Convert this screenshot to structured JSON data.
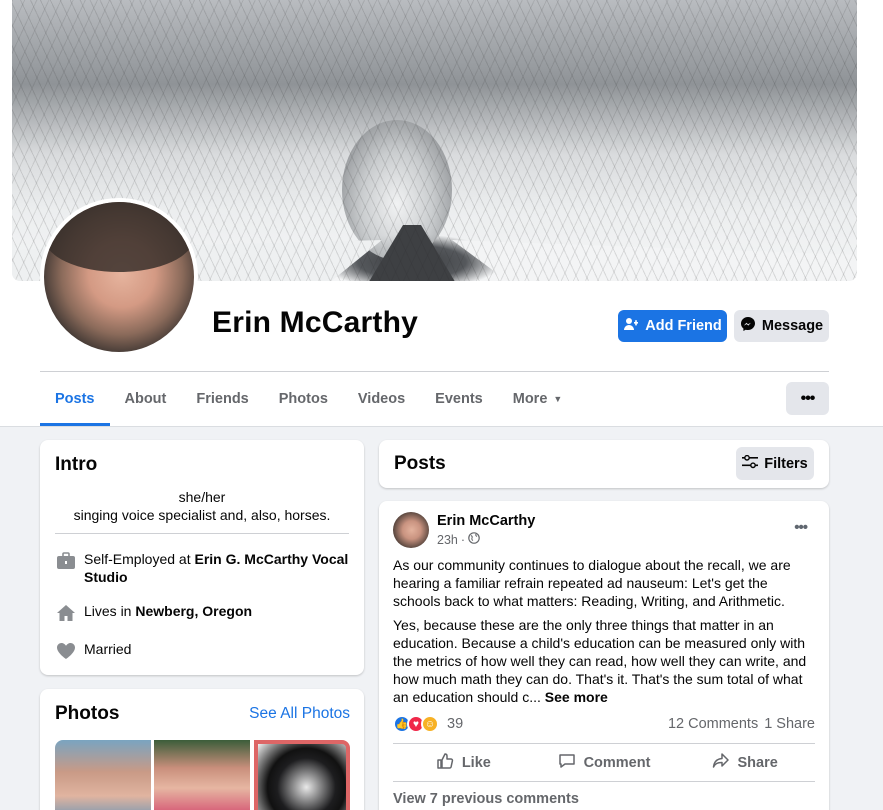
{
  "profile": {
    "name": "Erin McCarthy",
    "add_friend_label": "Add Friend",
    "message_label": "Message"
  },
  "tabs": [
    {
      "label": "Posts",
      "active": true
    },
    {
      "label": "About"
    },
    {
      "label": "Friends"
    },
    {
      "label": "Photos"
    },
    {
      "label": "Videos"
    },
    {
      "label": "Events"
    },
    {
      "label": "More"
    }
  ],
  "intro": {
    "title": "Intro",
    "pronouns": "she/her",
    "bio": "singing voice specialist and, also, horses.",
    "work_prefix": "Self-Employed at ",
    "work_place": "Erin G. McCarthy Vocal Studio",
    "lives_prefix": "Lives in ",
    "lives_place": "Newberg, Oregon",
    "relationship": "Married"
  },
  "photos": {
    "title": "Photos",
    "see_all": "See All Photos"
  },
  "posts_header": {
    "title": "Posts",
    "filters_label": "Filters"
  },
  "post": {
    "author": "Erin McCarthy",
    "time": "23h",
    "paragraph1": "As our community continues to dialogue about the recall, we are hearing a familiar refrain repeated ad nauseum: Let's get the schools back to what matters: Reading, Writing, and Arithmetic.",
    "paragraph2": "Yes, because these are the only three things that matter in an education.  Because a child's education can be measured only with the metrics of how well they can read, how well they can write, and how much math they can do.  That's it.  That's the sum total of what an education should c...",
    "see_more": "See more",
    "reaction_count": "39",
    "comments": "12 Comments",
    "shares": "1 Share",
    "like_label": "Like",
    "comment_label": "Comment",
    "share_label": "Share",
    "view_previous": "View 7 previous comments"
  },
  "colors": {
    "accent": "#1b74e4",
    "background": "#f0f2f5",
    "secondary_button": "#e4e6eb"
  }
}
